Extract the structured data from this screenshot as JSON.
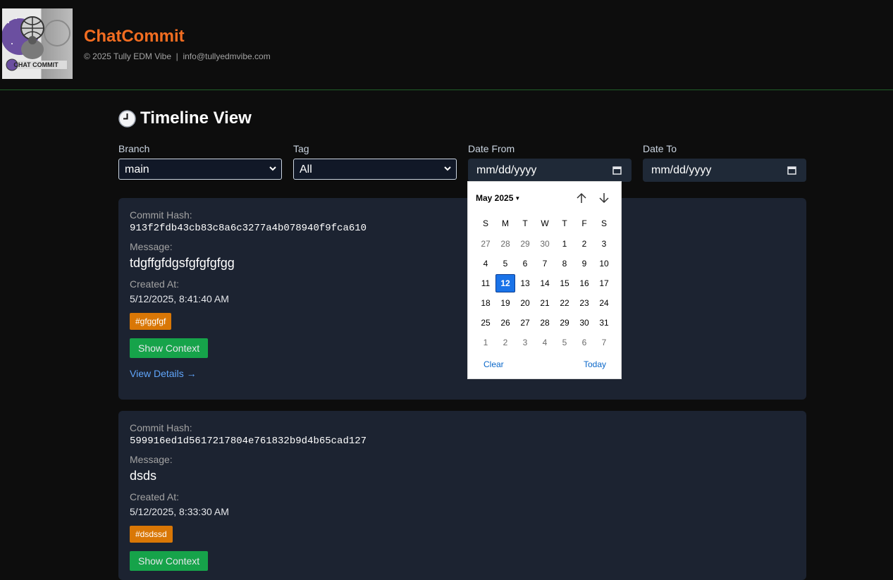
{
  "header": {
    "title": "ChatCommit",
    "subtitle": "© 2025 Tully EDM Vibe  |  info@tullyedmvibe.com",
    "logo_text": "CHAT COMMIT"
  },
  "page": {
    "title": "Timeline View",
    "title_icon": "clock-icon"
  },
  "filters": {
    "branch": {
      "label": "Branch",
      "value": "main"
    },
    "tag": {
      "label": "Tag",
      "value": "All"
    },
    "date_from": {
      "label": "Date From",
      "placeholder": "mm/dd/yyyy"
    },
    "date_to": {
      "label": "Date To",
      "placeholder": "mm/dd/yyyy"
    }
  },
  "commits": [
    {
      "hash_label": "Commit Hash:",
      "hash": "913f2fdb43cb83c8a6c3277a4b078940f9fca610",
      "message_label": "Message:",
      "message": "tdgffgfdgsfgfgfgfgg",
      "created_label": "Created At:",
      "created": "5/12/2025, 8:41:40 AM",
      "tag": "#gfggfgf",
      "context_button": "Show Context",
      "details_link": "View Details →"
    },
    {
      "hash_label": "Commit Hash:",
      "hash": "599916ed1d5617217804e761832b9d4b65cad127",
      "message_label": "Message:",
      "message": "dsds",
      "created_label": "Created At:",
      "created": "5/12/2025, 8:33:30 AM",
      "tag": "#dsdssd",
      "context_button": "Show Context"
    }
  ],
  "datepicker": {
    "month_label": "May 2025",
    "weekdays": [
      "S",
      "M",
      "T",
      "W",
      "T",
      "F",
      "S"
    ],
    "weeks": [
      [
        "27",
        "28",
        "29",
        "30",
        "1",
        "2",
        "3"
      ],
      [
        "4",
        "5",
        "6",
        "7",
        "8",
        "9",
        "10"
      ],
      [
        "11",
        "12",
        "13",
        "14",
        "15",
        "16",
        "17"
      ],
      [
        "18",
        "19",
        "20",
        "21",
        "22",
        "23",
        "24"
      ],
      [
        "25",
        "26",
        "27",
        "28",
        "29",
        "30",
        "31"
      ],
      [
        "1",
        "2",
        "3",
        "4",
        "5",
        "6",
        "7"
      ]
    ],
    "selected": "12",
    "clear_label": "Clear",
    "today_label": "Today"
  }
}
